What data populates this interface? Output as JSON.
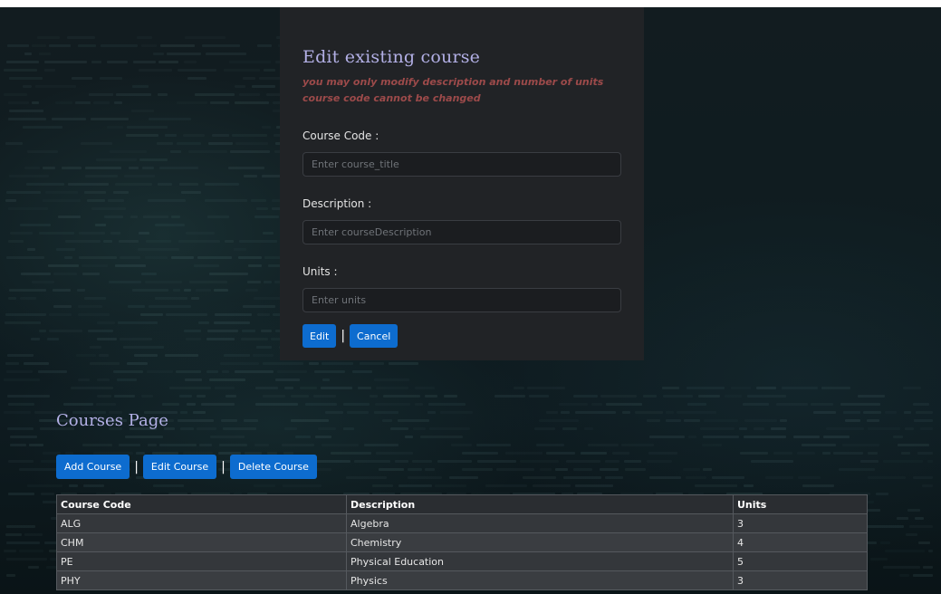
{
  "modal": {
    "title": "Edit existing course",
    "notes": [
      "you may only modify description and number of units",
      "course code cannot be changed"
    ],
    "fields": [
      {
        "label": "Course Code :",
        "placeholder": "Enter course_title",
        "value": ""
      },
      {
        "label": "Description :",
        "placeholder": "Enter courseDescription",
        "value": ""
      },
      {
        "label": "Units :",
        "placeholder": "Enter units",
        "value": ""
      }
    ],
    "edit_label": "Edit",
    "separator": "|",
    "cancel_label": "Cancel"
  },
  "page": {
    "title": "Courses Page",
    "add_label": "Add Course",
    "edit_label": "Edit Course",
    "delete_label": "Delete Course",
    "separator": "|"
  },
  "table": {
    "headers": [
      "Course Code",
      "Description",
      "Units"
    ],
    "rows": [
      [
        "ALG",
        "Algebra",
        "3"
      ],
      [
        "CHM",
        "Chemistry",
        "4"
      ],
      [
        "PE",
        "Physical Education",
        "5"
      ],
      [
        "PHY",
        "Physics",
        "3"
      ]
    ]
  },
  "colors": {
    "primary_button": "#0d6ccf",
    "title_text": "#b3b0e6",
    "note_text": "#9c4a4a",
    "modal_bg": "#212326"
  }
}
